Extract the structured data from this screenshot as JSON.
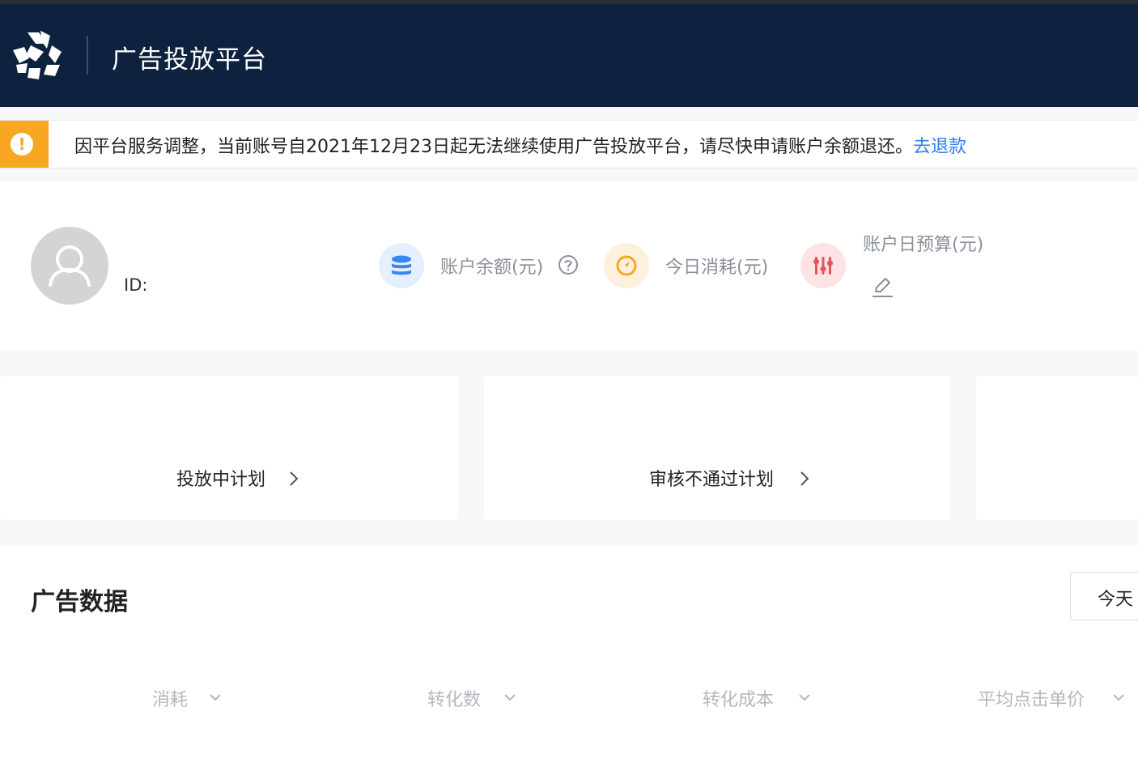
{
  "header": {
    "app_title": "广告投放平台",
    "logo_icon": "brand-logo-icon"
  },
  "notice": {
    "icon": "exclamation-icon",
    "text": "因平台服务调整，当前账号自2021年12月23日起无法继续使用广告投放平台，请尽快申请账户余额退还。",
    "link_label": "去退款",
    "accent_color": "#f7a721",
    "link_color": "#2e7ff0"
  },
  "account": {
    "avatar_icon": "user-icon",
    "id_label": "ID:",
    "metrics": {
      "balance": {
        "label": "账户余额(元)",
        "icon": "database-icon",
        "help_icon": "question-circle-icon"
      },
      "today_spend": {
        "label": "今日消耗(元)",
        "icon": "gauge-icon"
      },
      "daily_budget": {
        "label": "账户日预算(元)",
        "icon": "sliders-icon",
        "edit_icon": "edit-icon"
      }
    }
  },
  "plan_cards": [
    {
      "label": "投放中计划",
      "icon": "chevron-right-icon"
    },
    {
      "label": "审核不通过计划",
      "icon": "chevron-right-icon"
    },
    {
      "label": ""
    }
  ],
  "ad_data": {
    "title": "广告数据",
    "date_range": "今天",
    "stat_tabs": [
      "消耗",
      "转化数",
      "转化成本",
      "平均点击单价"
    ]
  }
}
